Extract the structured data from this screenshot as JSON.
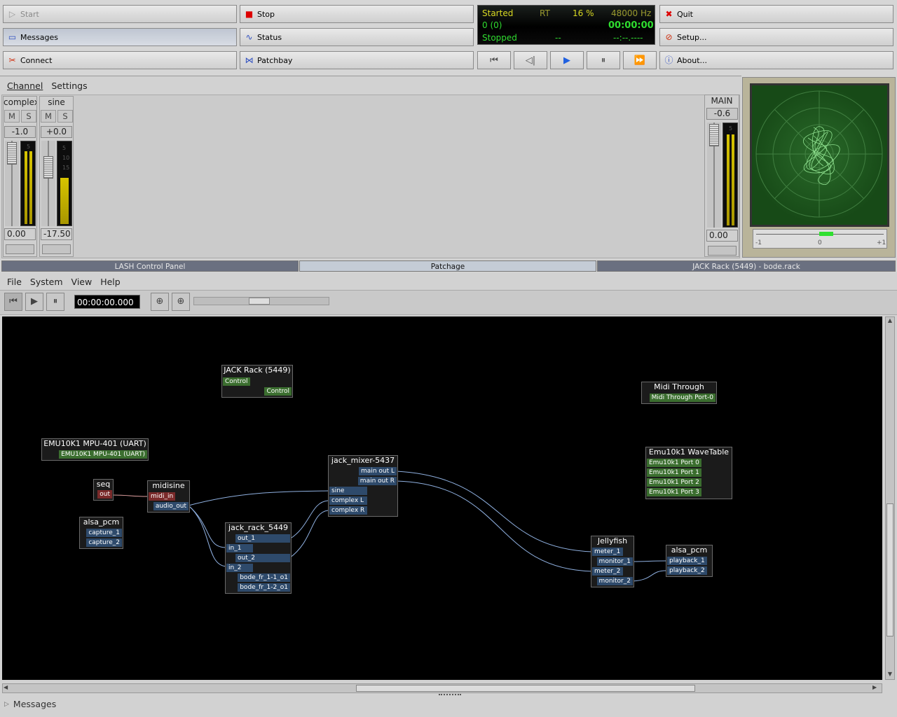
{
  "qjackctl": {
    "start_label": "Start",
    "stop_label": "Stop",
    "messages_label": "Messages",
    "status_label": "Status",
    "connect_label": "Connect",
    "patchbay_label": "Patchbay",
    "quit_label": "Quit",
    "setup_label": "Setup...",
    "about_label": "About...",
    "display": {
      "state": "Started",
      "rt": "RT",
      "load": "16 %",
      "rate": "48000 Hz",
      "xruns": "0 (0)",
      "time": "00:00:00",
      "transport": "Stopped",
      "bpm": "--",
      "bbt": "--:--.----"
    },
    "colors": {
      "display_green": "#2fdc2f",
      "display_yellow": "#d8d822",
      "dim": "#9a9a2e"
    }
  },
  "mixer": {
    "menu": [
      "Channel",
      "Settings"
    ],
    "channels": [
      {
        "name": "complex",
        "mute": "M",
        "solo": "S",
        "balance": "-1.0",
        "gain": "0.00",
        "scale": [
          "5"
        ]
      },
      {
        "name": "sine",
        "mute": "M",
        "solo": "S",
        "balance": "+0.0",
        "gain": "-17.50",
        "scale": [
          "5",
          "10",
          "15"
        ]
      }
    ],
    "main": {
      "name": "MAIN",
      "balance": "-0.6",
      "gain": "0.00",
      "scale": [
        "5"
      ]
    },
    "phase_scale": {
      "left": "-1",
      "center": "0",
      "right": "+1"
    }
  },
  "tabs": [
    {
      "label": "LASH Control Panel",
      "active": false
    },
    {
      "label": "Patchage",
      "active": true
    },
    {
      "label": "JACK Rack (5449) - bode.rack",
      "active": false
    }
  ],
  "patchage": {
    "menu": [
      "File",
      "System",
      "View",
      "Help"
    ],
    "time": "00:00:00.000",
    "modules": {
      "jack_rack_ctrl": {
        "title": "JACK Rack (5449)",
        "in": "Control",
        "out": "Control"
      },
      "midi_through": {
        "title": "Midi Through",
        "port": "Midi Through Port-0"
      },
      "emu_mpu": {
        "title": "EMU10K1 MPU-401 (UART)",
        "port": "EMU10K1 MPU-401 (UART)"
      },
      "emu_wavetable": {
        "title": "Emu10k1 WaveTable",
        "ports": [
          "Emu10k1 Port 0",
          "Emu10k1 Port 1",
          "Emu10k1 Port 2",
          "Emu10k1 Port 3"
        ]
      },
      "seq": {
        "title": "seq",
        "port": "out"
      },
      "midisine": {
        "title": "midisine",
        "in": "midi_in",
        "out": "audio_out"
      },
      "jack_mixer": {
        "title": "jack_mixer-5437",
        "outs": [
          "main out L",
          "main out R"
        ],
        "ins": [
          "sine",
          "complex L",
          "complex R"
        ]
      },
      "alsa_pcm_in": {
        "title": "alsa_pcm",
        "ports": [
          "capture_1",
          "capture_2"
        ]
      },
      "jack_rack": {
        "title": "jack_rack_5449",
        "ports": [
          "out_1",
          "in_1",
          "out_2",
          "in_2",
          "bode_fr_1-1_o1",
          "bode_fr_1-2_o1"
        ]
      },
      "jellyfish": {
        "title": "Jellyfish",
        "ports": [
          "meter_1",
          "monitor_1",
          "meter_2",
          "monitor_2"
        ]
      },
      "alsa_pcm_out": {
        "title": "alsa_pcm",
        "ports": [
          "playback_1",
          "playback_2"
        ]
      }
    },
    "messages_label": "Messages"
  }
}
